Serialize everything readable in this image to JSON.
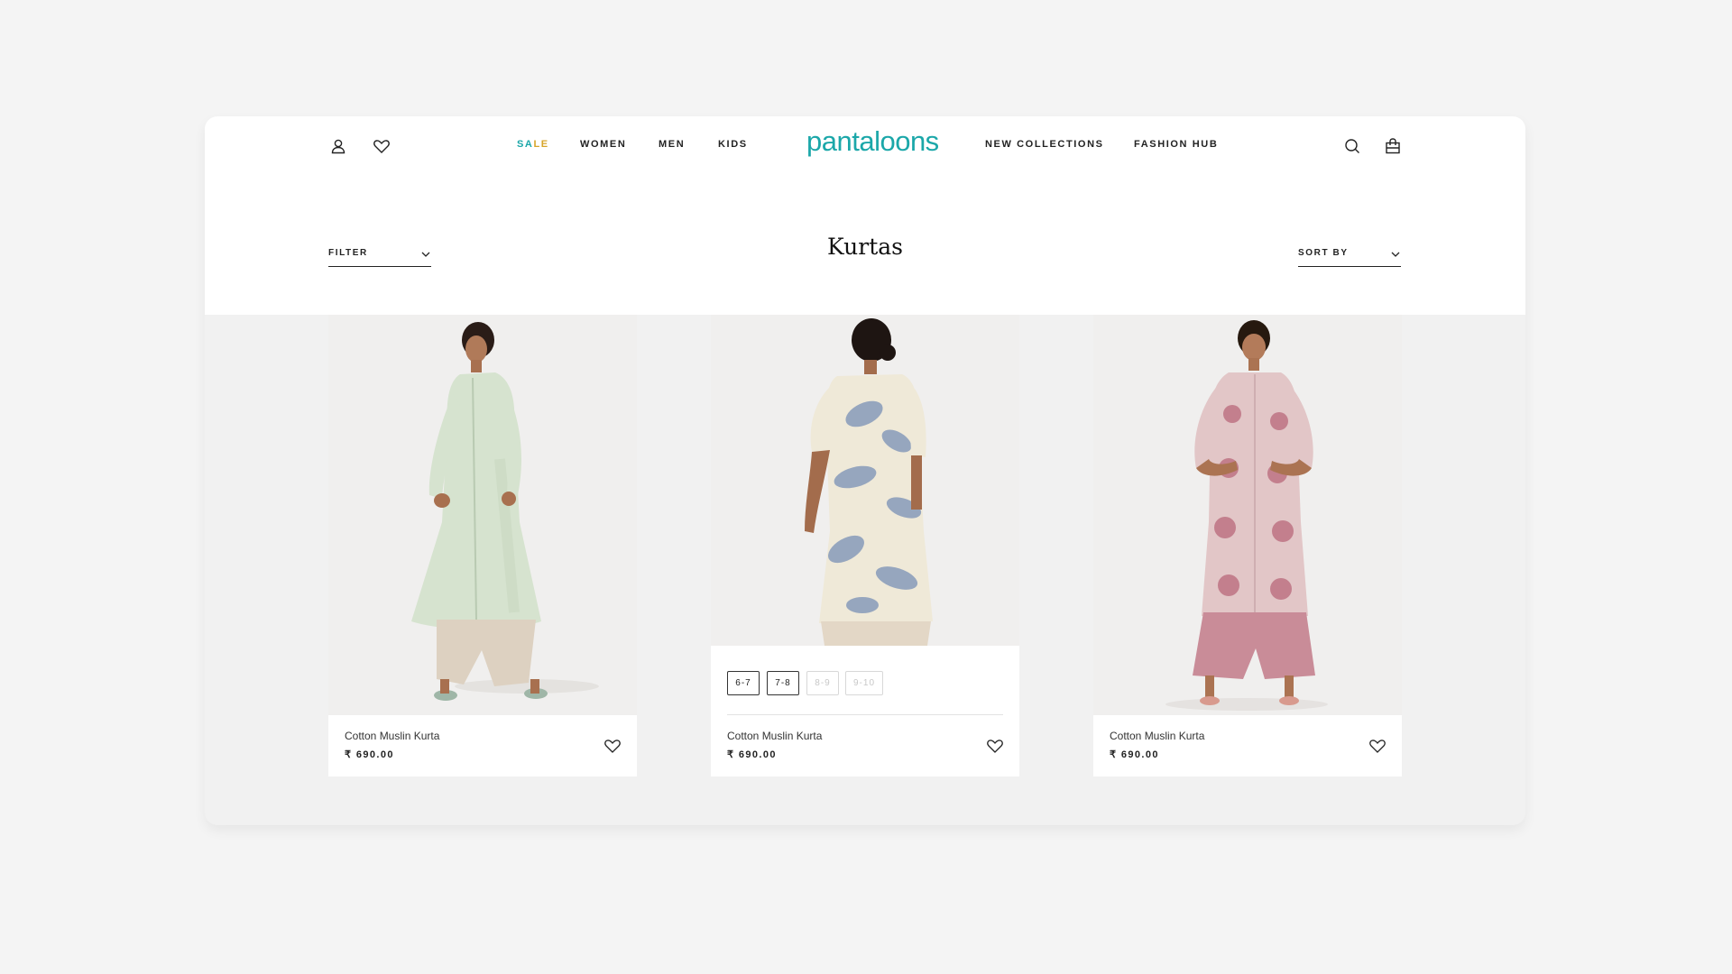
{
  "brand": {
    "logo_text": "pantaloons",
    "accent_color": "#1ba7a9",
    "sale_color_1": "#1ba7a9",
    "sale_color_2": "#d7a52a"
  },
  "nav": {
    "left_icons": [
      "user-icon",
      "heart-icon"
    ],
    "items": [
      {
        "label": "SALE"
      },
      {
        "label": "WOMEN"
      },
      {
        "label": "MEN"
      },
      {
        "label": "KIDS"
      },
      {
        "label": "NEW COLLECTIONS"
      },
      {
        "label": "FASHION HUB"
      }
    ],
    "right_icons": [
      "search-icon",
      "shopping-bag-icon"
    ]
  },
  "page": {
    "title": "Kurtas",
    "filter_label": "FILTER",
    "sort_label": "SORT BY"
  },
  "products": [
    {
      "name": "Cotton Muslin Kurta",
      "price": "₹ 690.00",
      "kurta_color": "#d6e3cf",
      "pants_color": "#ddd1c1",
      "sizes": []
    },
    {
      "name": "Cotton Muslin Kurta",
      "price": "₹ 690.00",
      "kurta_color": "#efe9d8",
      "print_color": "#7f95b8",
      "pants_color": "#e3d7c6",
      "sizes": [
        {
          "label": "6-7",
          "available": true
        },
        {
          "label": "7-8",
          "available": true
        },
        {
          "label": "8-9",
          "available": false
        },
        {
          "label": "9-10",
          "available": false
        }
      ]
    },
    {
      "name": "Cotton Muslin Kurta",
      "price": "₹ 690.00",
      "kurta_color": "#e2c6c7",
      "print_color": "#b8677a",
      "pants_color": "#c98c98",
      "sizes": []
    }
  ]
}
